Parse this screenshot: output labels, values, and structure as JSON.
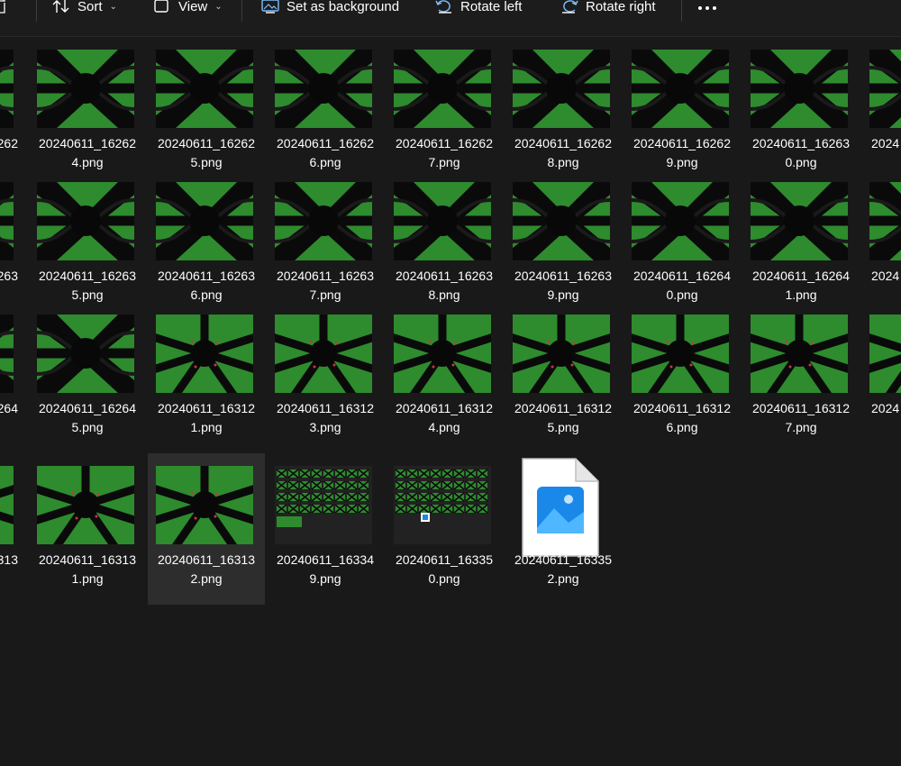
{
  "toolbar": {
    "sort": "Sort",
    "view": "View",
    "set_background": "Set as background",
    "rotate_left": "Rotate left",
    "rotate_right": "Rotate right"
  },
  "files": [
    {
      "line1": "",
      "line2": "",
      "thumb": "x"
    },
    {
      "line1": "20240611_16262",
      "line2": "4.png",
      "thumb": "x"
    },
    {
      "line1": "20240611_16262",
      "line2": "5.png",
      "thumb": "x"
    },
    {
      "line1": "20240611_16262",
      "line2": "6.png",
      "thumb": "x"
    },
    {
      "line1": "20240611_16262",
      "line2": "7.png",
      "thumb": "x"
    },
    {
      "line1": "20240611_16262",
      "line2": "8.png",
      "thumb": "x"
    },
    {
      "line1": "20240611_16262",
      "line2": "9.png",
      "thumb": "x"
    },
    {
      "line1": "20240611_16263",
      "line2": "0.png",
      "thumb": "x"
    },
    {
      "line1": "",
      "line2": "",
      "thumb": "x"
    },
    {
      "line1": "",
      "line2": "",
      "thumb": "x"
    },
    {
      "line1": "20240611_16263",
      "line2": "5.png",
      "thumb": "x"
    },
    {
      "line1": "20240611_16263",
      "line2": "6.png",
      "thumb": "x"
    },
    {
      "line1": "20240611_16263",
      "line2": "7.png",
      "thumb": "x"
    },
    {
      "line1": "20240611_16263",
      "line2": "8.png",
      "thumb": "x"
    },
    {
      "line1": "20240611_16263",
      "line2": "9.png",
      "thumb": "x"
    },
    {
      "line1": "20240611_16264",
      "line2": "0.png",
      "thumb": "x"
    },
    {
      "line1": "20240611_16264",
      "line2": "1.png",
      "thumb": "x"
    },
    {
      "line1": "",
      "line2": "",
      "thumb": "x"
    },
    {
      "line1": "",
      "line2": "",
      "thumb": "x"
    },
    {
      "line1": "20240611_16264",
      "line2": "5.png",
      "thumb": "x"
    },
    {
      "line1": "20240611_16312",
      "line2": "1.png",
      "thumb": "star"
    },
    {
      "line1": "20240611_16312",
      "line2": "3.png",
      "thumb": "star"
    },
    {
      "line1": "20240611_16312",
      "line2": "4.png",
      "thumb": "star"
    },
    {
      "line1": "20240611_16312",
      "line2": "5.png",
      "thumb": "star"
    },
    {
      "line1": "20240611_16312",
      "line2": "6.png",
      "thumb": "star"
    },
    {
      "line1": "20240611_16312",
      "line2": "7.png",
      "thumb": "star"
    },
    {
      "line1": "",
      "line2": "",
      "thumb": "star"
    },
    {
      "line1": "",
      "line2": "",
      "thumb": "star"
    },
    {
      "line1": "20240611_16313",
      "line2": "1.png",
      "thumb": "star"
    },
    {
      "line1": "20240611_16313",
      "line2": "2.png",
      "thumb": "star",
      "selected": true
    },
    {
      "line1": "20240611_16334",
      "line2": "9.png",
      "thumb": "grid"
    },
    {
      "line1": "20240611_16335",
      "line2": "0.png",
      "thumb": "grid2"
    },
    {
      "line1": "20240611_16335",
      "line2": "2.png",
      "thumb": "doc"
    }
  ],
  "cut_labels": [
    {
      "row": 0,
      "side": "left",
      "text": "262"
    },
    {
      "row": 0,
      "side": "right",
      "text": "2024"
    },
    {
      "row": 1,
      "side": "left",
      "text": "263"
    },
    {
      "row": 1,
      "side": "right",
      "text": "2024"
    },
    {
      "row": 2,
      "side": "left",
      "text": "264"
    },
    {
      "row": 2,
      "side": "right",
      "text": "2024"
    },
    {
      "row": 3,
      "side": "left",
      "text": "313"
    }
  ],
  "colors": {
    "green": "#2e8b2e",
    "selected": "#2d2d2d",
    "background": "#191919"
  }
}
